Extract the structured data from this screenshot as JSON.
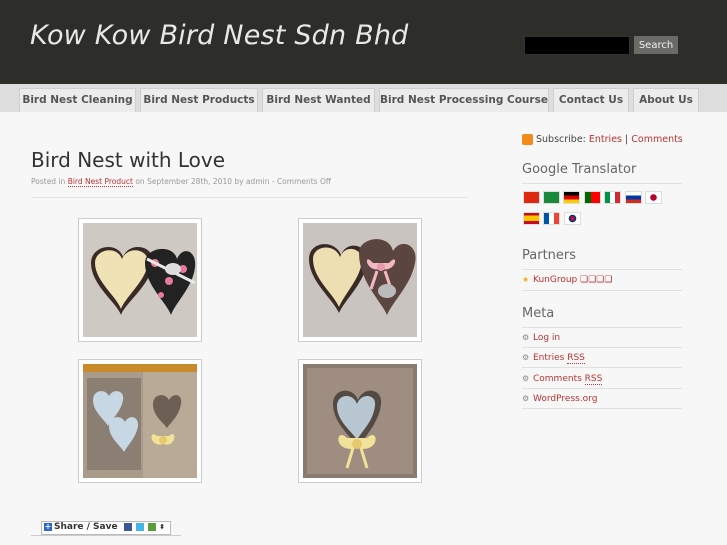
{
  "header": {
    "site_title": "Kow Kow Bird Nest Sdn Bhd",
    "search_button": "Search",
    "search_value": ""
  },
  "nav": [
    "Bird Nest Cleaning",
    "Bird Nest Products",
    "Bird Nest Wanted",
    "Bird Nest Processing Course",
    "Contact Us",
    "About Us"
  ],
  "post": {
    "title": "Bird Nest with Love",
    "meta_prefix": "Posted in ",
    "category": "Bird Nest Product",
    "meta_suffix": " on September 28th, 2010 by admin - Comments Off"
  },
  "share": {
    "label": "Share / Save"
  },
  "sidebar": {
    "subscribe_label": "Subscribe:",
    "entries": "Entries",
    "separator": "|",
    "comments": "Comments",
    "translator_title": "Google Translator",
    "partners_title": "Partners",
    "partner_link": "KunGroup ❏❏❏❏",
    "meta_title": "Meta",
    "meta_links": {
      "login": "Log in",
      "entries_pre": "Entries ",
      "comments_pre": "Comments ",
      "rss": "RSS",
      "wordpress": "WordPress.org"
    }
  },
  "colors": {
    "header_bg": "#2d2d2a",
    "link": "#b33333",
    "nav_bg": "#ececec"
  }
}
